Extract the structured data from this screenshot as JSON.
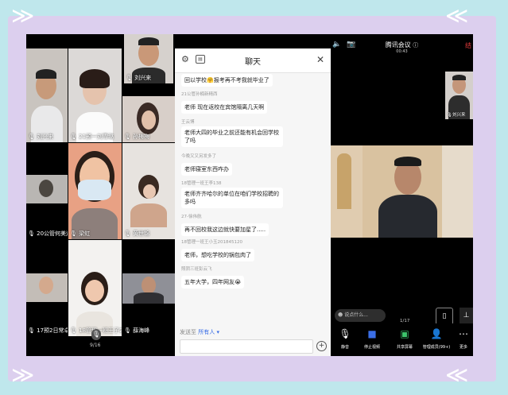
{
  "meeting": {
    "title": "腾讯会议",
    "time": "00:43",
    "page_indicator": "1/17",
    "left_page_indicator": "9/16",
    "speak_placeholder": "说点什么...",
    "leave_label": "结"
  },
  "participants": [
    {
      "name": "刘兴来"
    },
    {
      "name": "21预一刘雪璐"
    },
    {
      "name": "孙梅梅"
    },
    {
      "name": "梁虹"
    },
    {
      "name": "黄世锦"
    },
    {
      "name": "20公管何美运"
    },
    {
      "name": "17预2日常卓曦"
    },
    {
      "name": "18管理一班王子201"
    },
    {
      "name": "薛海峰"
    },
    {
      "name": "刘兴来"
    }
  ],
  "chat": {
    "title": "聊天",
    "send_to_label": "发送至",
    "send_to_value": "所有人",
    "messages": [
      {
        "sender": "",
        "text": "回以学校🤗报考再不考我就毕业了"
      },
      {
        "sender": "21公管孙楠新精西",
        "text": "老师 现在返校在宾馆隔离几天啊"
      },
      {
        "sender": "王云博",
        "text": "老师大四的毕业之前还能有机会回学校了吗"
      },
      {
        "sender": "今晚又又另发多了",
        "text": "老师寝室东西咋办"
      },
      {
        "sender": "18管理一班王李138",
        "text": "老师齐齐哈尔的单位在咱们学校招聘的多吗"
      },
      {
        "sender": "27-徐伟航",
        "text": "再不回校我这边就快要加星了....."
      },
      {
        "sender": "18管理一班王小玉201845120",
        "text": "老师，想吃学校的锅包肉了"
      },
      {
        "sender": "照阴三班彭云飞",
        "text": "五年大学，四年网友😭"
      }
    ]
  },
  "toolbar": {
    "mute": "静音",
    "stop_video": "停止视频",
    "share_screen": "共享屏幕",
    "manage_members": "管理成员(99+)",
    "more": "更多"
  },
  "icons": [
    "settings-icon",
    "whiteboard-icon",
    "close-icon",
    "microphone-icon",
    "video-icon",
    "share-screen-icon",
    "members-icon",
    "more-icon",
    "speaker-icon",
    "camera-switch-icon",
    "info-icon",
    "plus-icon",
    "dropdown-icon",
    "emoji-icon",
    "mobile-icon"
  ],
  "colors": {
    "accent": "#3b6ee6",
    "background": "#bfe7ec",
    "frame": "#dccfee",
    "danger": "#e23b3b"
  }
}
